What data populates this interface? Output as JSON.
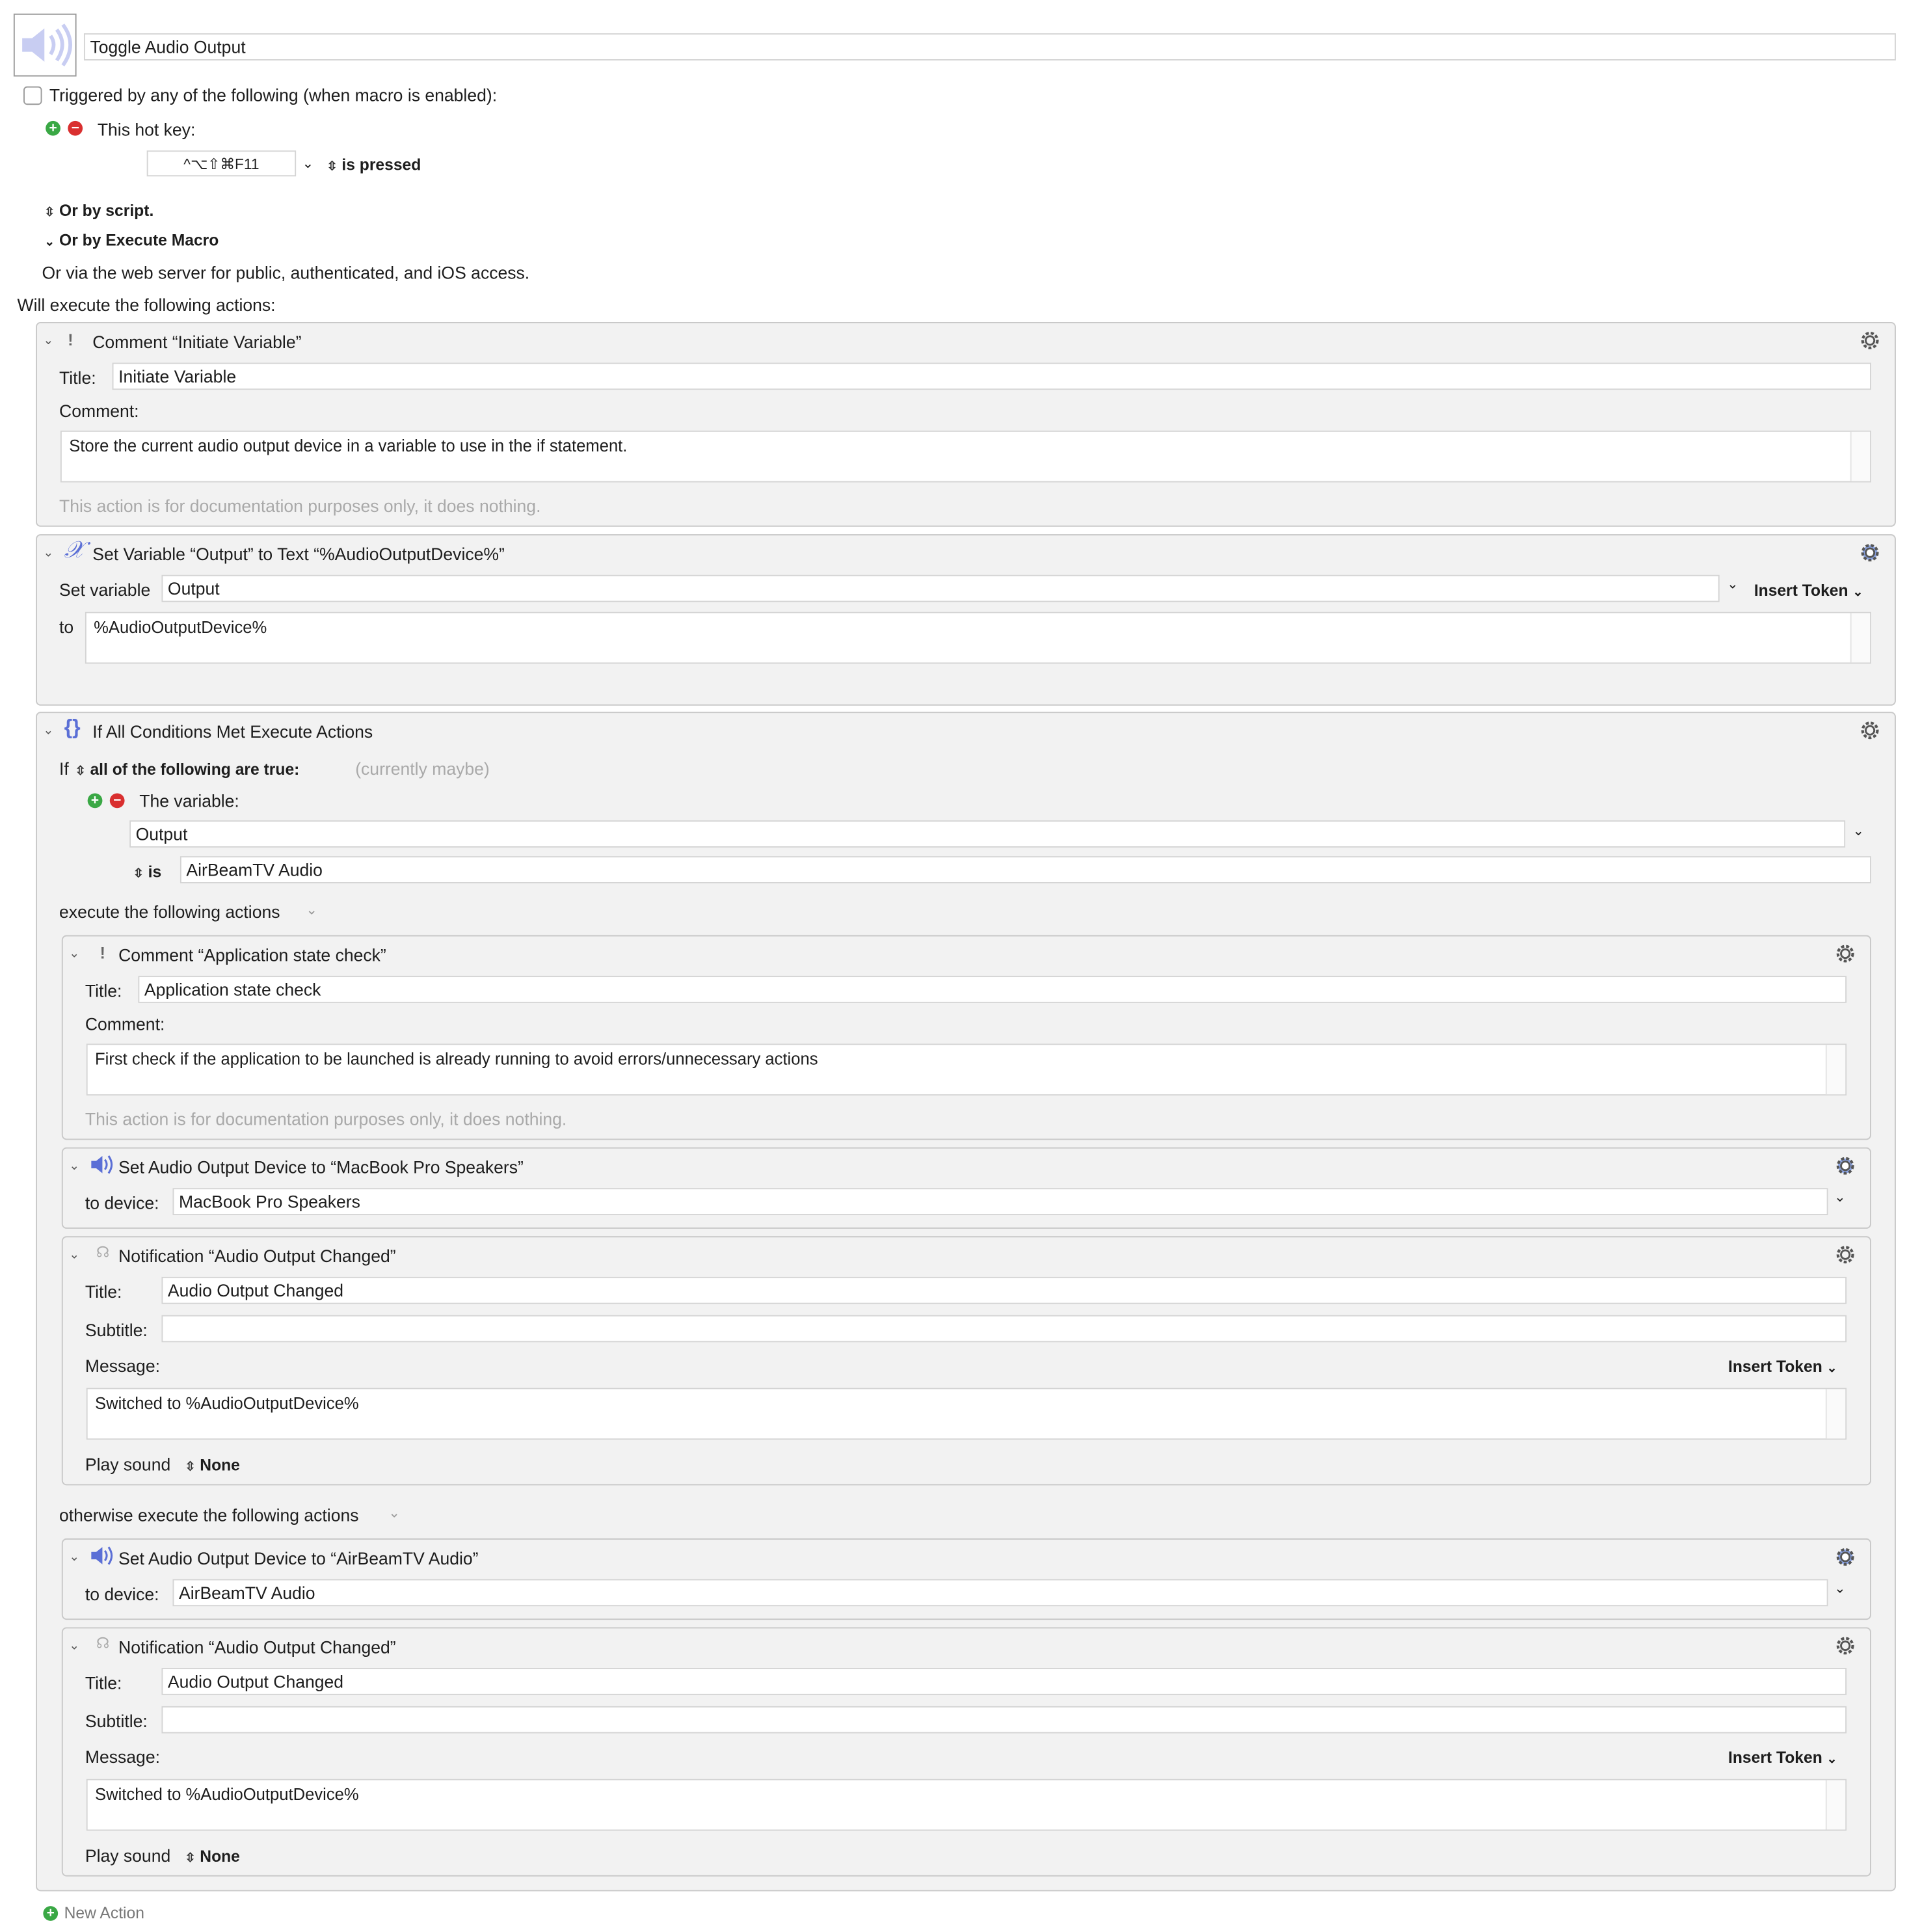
{
  "macro": {
    "name": "Toggle Audio Output",
    "trigger_label": "Triggered by any of the following (when macro is enabled):",
    "hotkey_label": "This hot key:",
    "hotkey_value": "^⌥⇧⌘F11",
    "hotkey_mode": "is pressed",
    "or_script": "Or by script.",
    "or_execute": "Or by Execute Macro",
    "web_server": "Or via the web server for public, authenticated, and iOS access.",
    "will_execute": "Will execute the following actions:",
    "new_action": "New Action"
  },
  "comment1": {
    "header": "Comment “Initiate Variable”",
    "title_label": "Title:",
    "title_value": "Initiate Variable",
    "comment_label": "Comment:",
    "comment_value": "Store the current audio output device in a variable to use in the if statement.",
    "doc_note": "This action is for documentation purposes only, it does nothing."
  },
  "setvar": {
    "header": "Set Variable “Output” to Text “%AudioOutputDevice%”",
    "set_label": "Set variable",
    "var_value": "Output",
    "insert_token": "Insert Token",
    "to_label": "to",
    "to_value": "%AudioOutputDevice%"
  },
  "ifblock": {
    "header": "If All Conditions Met Execute Actions",
    "if_label": "If",
    "condition_mode": "all of the following are true:",
    "status": "(currently maybe)",
    "variable_label": "The variable:",
    "variable_value": "Output",
    "is_label": "is",
    "is_value": "AirBeamTV Audio",
    "then_label": "execute the following actions",
    "else_label": "otherwise execute the following actions"
  },
  "comment2": {
    "header": "Comment “Application state check”",
    "title_label": "Title:",
    "title_value": "Application state check",
    "comment_label": "Comment:",
    "comment_value": "First check if the application to be launched is already running to avoid errors/unnecessary actions",
    "doc_note": "This action is for documentation purposes only, it does nothing."
  },
  "audio1": {
    "header": "Set Audio Output Device to “MacBook Pro Speakers”",
    "device_label": "to device:",
    "device_value": "MacBook Pro Speakers"
  },
  "notif1": {
    "header": "Notification “Audio Output Changed”",
    "title_label": "Title:",
    "title_value": "Audio Output Changed",
    "subtitle_label": "Subtitle:",
    "subtitle_value": "",
    "message_label": "Message:",
    "insert_token": "Insert Token",
    "message_value": "Switched to %AudioOutputDevice%",
    "sound_label": "Play sound",
    "sound_value": "None"
  },
  "audio2": {
    "header": "Set Audio Output Device to “AirBeamTV Audio”",
    "device_label": "to device:",
    "device_value": "AirBeamTV Audio"
  },
  "notif2": {
    "header": "Notification “Audio Output Changed”",
    "title_label": "Title:",
    "title_value": "Audio Output Changed",
    "subtitle_label": "Subtitle:",
    "subtitle_value": "",
    "message_label": "Message:",
    "insert_token": "Insert Token",
    "message_value": "Switched to %AudioOutputDevice%",
    "sound_label": "Play sound",
    "sound_value": "None"
  },
  "icons": {
    "macro": "speaker-icon",
    "comment": "exclamation-icon",
    "variable": "variable-x-icon",
    "if": "braces-icon",
    "audio": "speaker-icon",
    "notification": "notification-icon",
    "gear": "gear-icon"
  },
  "colors": {
    "panel": "#f2f2f2",
    "accent_icon": "#5b6fd6",
    "plus": "#3aa845",
    "minus": "#d92f2f"
  }
}
